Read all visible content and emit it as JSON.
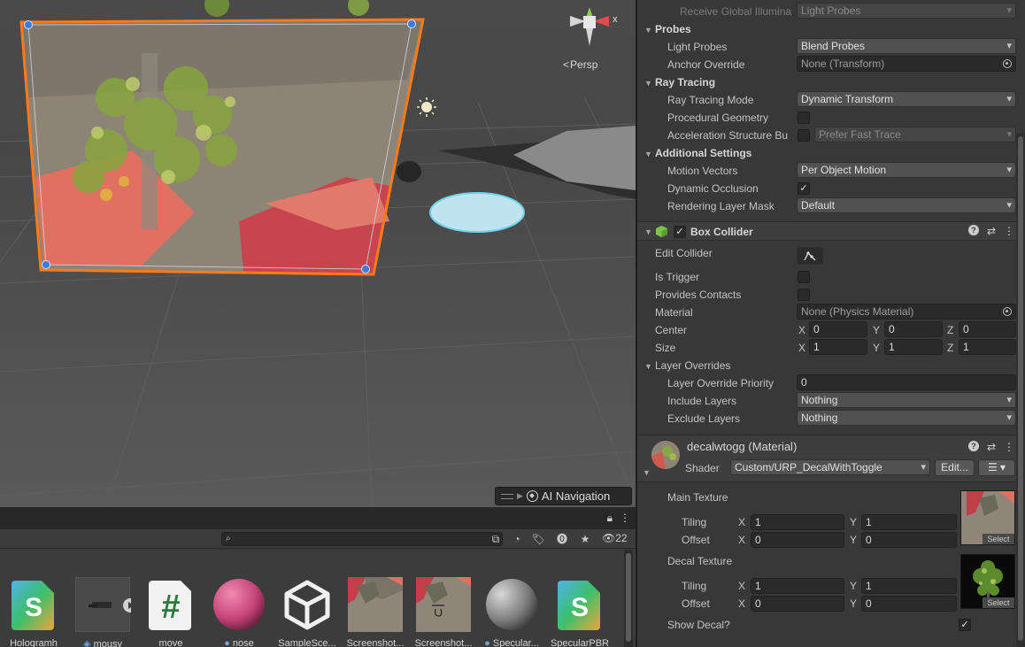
{
  "scene": {
    "projection_label": "Persp",
    "gizmo_axis_label": "x",
    "ai_navigation_label": "AI Navigation"
  },
  "project": {
    "visible_count": "22",
    "assets": [
      {
        "name": "Hologramh",
        "kind": "shader-graph"
      },
      {
        "name": "mousy",
        "kind": "prefab"
      },
      {
        "name": "move",
        "kind": "script"
      },
      {
        "name": "nose",
        "kind": "material-pink"
      },
      {
        "name": "SampleSce...",
        "kind": "unity-scene"
      },
      {
        "name": "Screenshot...",
        "kind": "texture"
      },
      {
        "name": "Screenshot...",
        "kind": "texture"
      },
      {
        "name": "Specular...",
        "kind": "material-grey"
      },
      {
        "name": "SpecularPBR",
        "kind": "shader-graph"
      }
    ]
  },
  "inspector": {
    "receive_gi": {
      "label": "Receive Global Illumina",
      "value": "Light Probes"
    },
    "probes": {
      "title": "Probes",
      "light_probes": {
        "label": "Light Probes",
        "value": "Blend Probes"
      },
      "anchor_override": {
        "label": "Anchor Override",
        "value": "None (Transform)"
      }
    },
    "ray_tracing": {
      "title": "Ray Tracing",
      "mode": {
        "label": "Ray Tracing Mode",
        "value": "Dynamic Transform"
      },
      "procedural": {
        "label": "Procedural Geometry"
      },
      "accel": {
        "label": "Acceleration Structure Bu",
        "value": "Prefer Fast Trace"
      }
    },
    "additional": {
      "title": "Additional Settings",
      "motion_vectors": {
        "label": "Motion Vectors",
        "value": "Per Object Motion"
      },
      "dynamic_occlusion": {
        "label": "Dynamic Occlusion"
      },
      "rendering_layer_mask": {
        "label": "Rendering Layer Mask",
        "value": "Default"
      }
    },
    "box_collider": {
      "title": "Box Collider",
      "edit_collider": "Edit Collider",
      "is_trigger": "Is Trigger",
      "provides_contacts": "Provides Contacts",
      "material": {
        "label": "Material",
        "value": "None (Physics Material)"
      },
      "center": {
        "label": "Center",
        "x": "0",
        "y": "0",
        "z": "0"
      },
      "size": {
        "label": "Size",
        "x": "1",
        "y": "1",
        "z": "1"
      },
      "axis_x": "X",
      "axis_y": "Y",
      "axis_z": "Z",
      "layer_overrides": {
        "title": "Layer Overrides",
        "priority": {
          "label": "Layer Override Priority",
          "value": "0"
        },
        "include": {
          "label": "Include Layers",
          "value": "Nothing"
        },
        "exclude": {
          "label": "Exclude Layers",
          "value": "Nothing"
        }
      }
    },
    "material": {
      "name": "decalwtogg (Material)",
      "shader_label": "Shader",
      "shader_value": "Custom/URP_DecalWithToggle",
      "edit_label": "Edit...",
      "main_texture": "Main Texture",
      "decal_texture": "Decal Texture",
      "tiling": "Tiling",
      "offset": "Offset",
      "axis_x": "X",
      "axis_y": "Y",
      "main_tiling": {
        "x": "1",
        "y": "1"
      },
      "main_offset": {
        "x": "0",
        "y": "0"
      },
      "decal_tiling": {
        "x": "1",
        "y": "1"
      },
      "decal_offset": {
        "x": "0",
        "y": "0"
      },
      "select_label": "Select",
      "show_decal": "Show Decal?"
    }
  },
  "colors": {
    "selection_outline": "#ff7a1a",
    "handle_blue": "#3b7bdc",
    "panel_bg": "#383838"
  }
}
